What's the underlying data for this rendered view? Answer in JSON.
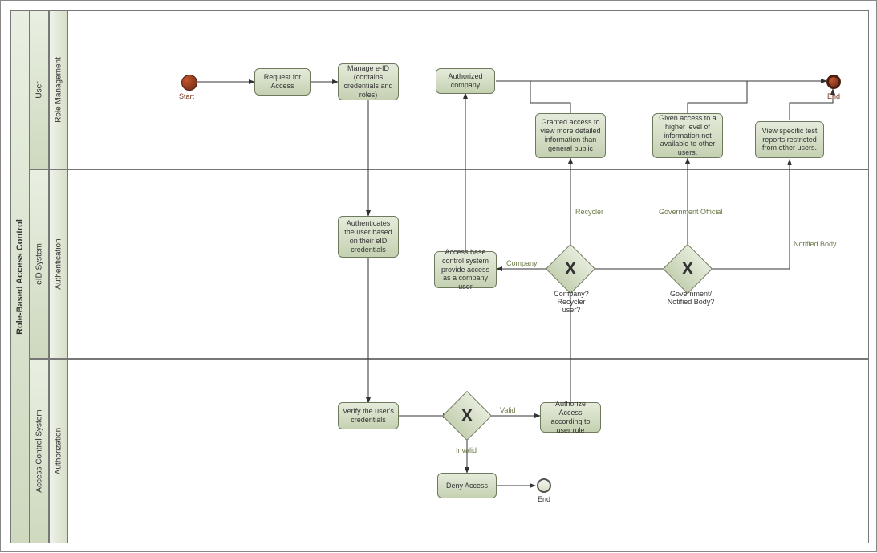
{
  "pool": {
    "title": "Role-Based Access Control"
  },
  "lanes": {
    "user": {
      "title": "User",
      "sub": "Role Management"
    },
    "eid": {
      "title": "eID System",
      "sub": "Authentication"
    },
    "acs": {
      "title": "Access Control System",
      "sub": "Authorization"
    }
  },
  "events": {
    "start": "Start",
    "end_main": "End",
    "end_deny": "End"
  },
  "tasks": {
    "request": "Request for Access",
    "manage": "Manage e-ID (contains credentials and roles)",
    "authcomp": "Authorized company",
    "granted_recycler": "Granted access to view more detailed information than general public",
    "given_gov": "Given access to a higher level of information not available to other users.",
    "view_nb": "View specific test reports restricted from other users.",
    "authenticates": "Authenticates the user based on their eID credentials",
    "access_company": "Access base control system provide access as a company user",
    "verify": "Verify the user's credentials",
    "authorize": "Authorize Access according to user role",
    "deny": "Deny Access"
  },
  "gateways": {
    "valid": {
      "label_valid": "Valid",
      "label_invalid": "Invalid"
    },
    "company_recycler": {
      "title": "Company? Recycler user?",
      "branch_company": "Company",
      "branch_recycler": "Recycler"
    },
    "gov_nb": {
      "title": "Government/ Notified Body?",
      "branch_gov": "Government Official",
      "branch_nb": "Notified Body"
    }
  }
}
